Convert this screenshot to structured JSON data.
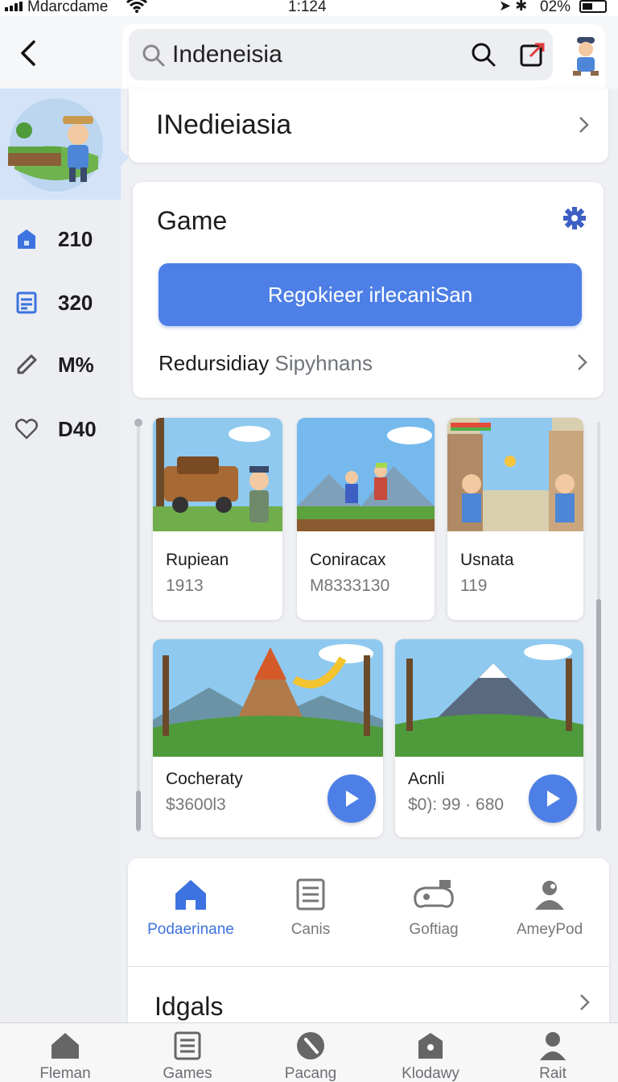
{
  "status_bar": {
    "carrier": "Mdarcdame",
    "time": "1:124",
    "battery": "02%"
  },
  "search": {
    "value": "Indeneisia"
  },
  "country_card": {
    "title": "INedieiasia"
  },
  "sidebar": {
    "stats": [
      {
        "icon": "bank-icon",
        "value": "210"
      },
      {
        "icon": "calendar-icon",
        "value": "320"
      },
      {
        "icon": "tag-icon",
        "value": "M%"
      },
      {
        "icon": "heart-icon",
        "value": "D40"
      }
    ]
  },
  "game_card": {
    "title": "Game",
    "button_label": "Regokieer irlecaniSan",
    "sub_label": "Redursidiay",
    "sub_muted": "Sipyhnans"
  },
  "tiles": [
    {
      "name": "Rupiean",
      "price": "1913"
    },
    {
      "name": "Coniracax",
      "price": "M8333130"
    },
    {
      "name": "Usnata",
      "price": "119"
    },
    {
      "name": "Cocheraty",
      "price": "$3600l3"
    },
    {
      "name": "Acnli",
      "price": "$0): 99 · 680"
    }
  ],
  "nav_card": {
    "items": [
      {
        "icon": "home-icon",
        "label": "Podaerinane",
        "active": true
      },
      {
        "icon": "list-icon",
        "label": "Canis",
        "active": false
      },
      {
        "icon": "gamepad-icon",
        "label": "Goftiag",
        "active": false
      },
      {
        "icon": "person-icon",
        "label": "AmeyPod",
        "active": false
      }
    ],
    "footer_title": "Idgals"
  },
  "tabbar": {
    "tabs": [
      {
        "icon": "home-icon",
        "label": "Fleman"
      },
      {
        "icon": "list-icon",
        "label": "Games"
      },
      {
        "icon": "compass-icon",
        "label": "Pacang"
      },
      {
        "icon": "bag-icon",
        "label": "Klodawy"
      },
      {
        "icon": "person-icon",
        "label": "Rait"
      }
    ]
  },
  "colors": {
    "accent": "#4d7fe6",
    "active_nav": "#3d73e0",
    "rail_highlight": "#d4e3f8"
  }
}
